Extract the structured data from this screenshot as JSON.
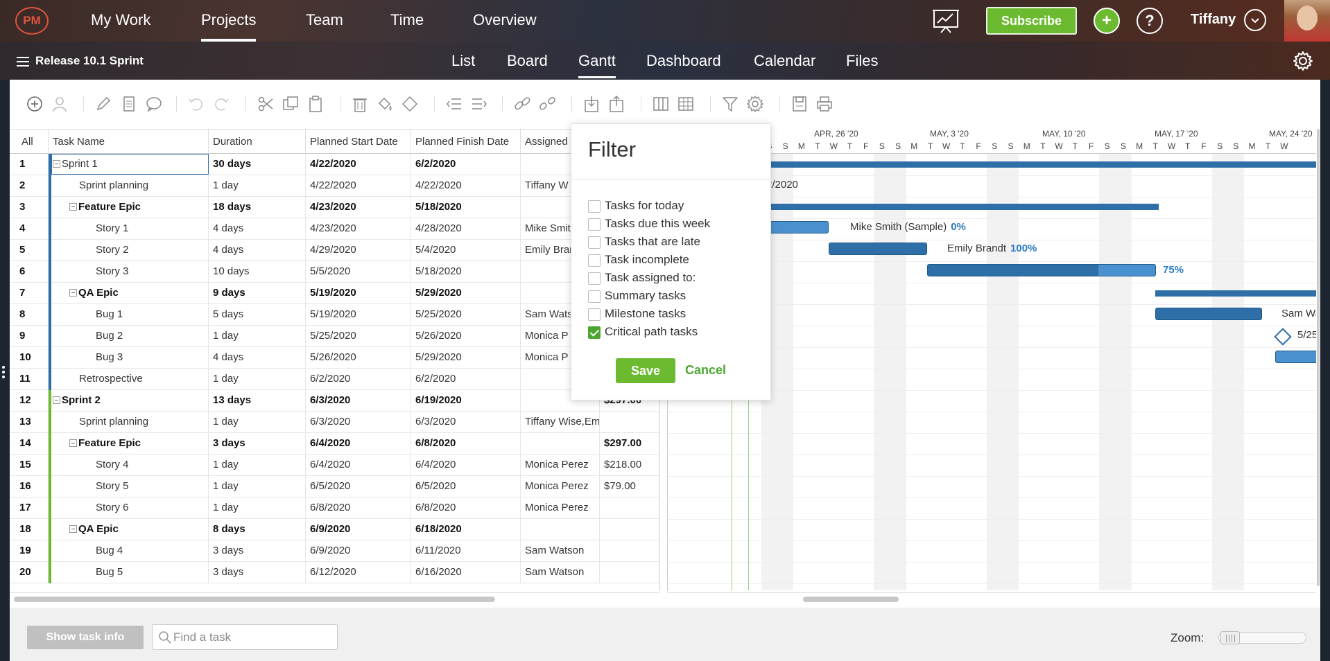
{
  "topnav": {
    "logo": "PM",
    "items": [
      {
        "label": "My Work",
        "active": false
      },
      {
        "label": "Projects",
        "active": true
      },
      {
        "label": "Team",
        "active": false
      },
      {
        "label": "Time",
        "active": false
      },
      {
        "label": "Overview",
        "active": false
      }
    ],
    "subscribe_label": "Subscribe",
    "user_name": "Tiffany"
  },
  "project": {
    "title": "Release 10.1 Sprint",
    "views": [
      {
        "label": "List",
        "active": false
      },
      {
        "label": "Board",
        "active": false
      },
      {
        "label": "Gantt",
        "active": true
      },
      {
        "label": "Dashboard",
        "active": false
      },
      {
        "label": "Calendar",
        "active": false
      },
      {
        "label": "Files",
        "active": false
      }
    ]
  },
  "toolbar_icons": [
    "add-task-icon",
    "assign-user-icon",
    "edit-icon",
    "notes-icon",
    "comment-icon",
    "undo-icon",
    "redo-icon",
    "cut-icon",
    "copy-icon",
    "paste-icon",
    "delete-icon",
    "fill-color-icon",
    "clear-format-icon",
    "outdent-icon",
    "indent-icon",
    "link-icon",
    "unlink-icon",
    "import-icon",
    "export-icon",
    "columns-icon",
    "table-icon",
    "filter-icon",
    "settings-icon",
    "save-baseline-icon",
    "print-icon"
  ],
  "grid": {
    "columns": [
      "All",
      "Task Name",
      "Duration",
      "Planned Start Date",
      "Planned Finish Date",
      "Assigned"
    ],
    "rows": [
      {
        "num": "1",
        "name": "Sprint 1",
        "duration": "30 days",
        "start": "4/22/2020",
        "finish": "6/2/2020",
        "assigned": "",
        "cost": "",
        "level": 0,
        "summary": true,
        "sprint": 1
      },
      {
        "num": "2",
        "name": "Sprint planning",
        "duration": "1 day",
        "start": "4/22/2020",
        "finish": "4/22/2020",
        "assigned": "Tiffany W",
        "cost": "",
        "level": 1,
        "summary": false,
        "sprint": 1
      },
      {
        "num": "3",
        "name": "Feature Epic",
        "duration": "18 days",
        "start": "4/23/2020",
        "finish": "5/18/2020",
        "assigned": "",
        "cost": "",
        "level": 1,
        "summary": true,
        "sprint": 1
      },
      {
        "num": "4",
        "name": "Story 1",
        "duration": "4 days",
        "start": "4/23/2020",
        "finish": "4/28/2020",
        "assigned": "Mike Smit",
        "cost": "",
        "level": 2,
        "summary": false,
        "sprint": 1
      },
      {
        "num": "5",
        "name": "Story 2",
        "duration": "4 days",
        "start": "4/29/2020",
        "finish": "5/4/2020",
        "assigned": "Emily Bran",
        "cost": "",
        "level": 2,
        "summary": false,
        "sprint": 1
      },
      {
        "num": "6",
        "name": "Story 3",
        "duration": "10 days",
        "start": "5/5/2020",
        "finish": "5/18/2020",
        "assigned": "",
        "cost": "",
        "level": 2,
        "summary": false,
        "sprint": 1
      },
      {
        "num": "7",
        "name": "QA Epic",
        "duration": "9 days",
        "start": "5/19/2020",
        "finish": "5/29/2020",
        "assigned": "",
        "cost": "",
        "level": 1,
        "summary": true,
        "sprint": 1
      },
      {
        "num": "8",
        "name": "Bug 1",
        "duration": "5 days",
        "start": "5/19/2020",
        "finish": "5/25/2020",
        "assigned": "Sam Wats",
        "cost": "",
        "level": 2,
        "summary": false,
        "sprint": 1
      },
      {
        "num": "9",
        "name": "Bug 2",
        "duration": "1 day",
        "start": "5/25/2020",
        "finish": "5/26/2020",
        "assigned": "Monica P",
        "cost": "",
        "level": 2,
        "summary": false,
        "sprint": 1
      },
      {
        "num": "10",
        "name": "Bug 3",
        "duration": "4 days",
        "start": "5/26/2020",
        "finish": "5/29/2020",
        "assigned": "Monica P",
        "cost": "",
        "level": 2,
        "summary": false,
        "sprint": 1
      },
      {
        "num": "11",
        "name": "Retrospective",
        "duration": "1 day",
        "start": "6/2/2020",
        "finish": "6/2/2020",
        "assigned": "",
        "cost": "",
        "level": 1,
        "summary": false,
        "sprint": 1
      },
      {
        "num": "12",
        "name": "Sprint 2",
        "duration": "13 days",
        "start": "6/3/2020",
        "finish": "6/19/2020",
        "assigned": "",
        "cost": "$297.00",
        "level": 0,
        "summary": true,
        "sprint": 2
      },
      {
        "num": "13",
        "name": "Sprint planning",
        "duration": "1 day",
        "start": "6/3/2020",
        "finish": "6/3/2020",
        "assigned": "Tiffany Wise,Em",
        "cost": "",
        "level": 1,
        "summary": false,
        "sprint": 2
      },
      {
        "num": "14",
        "name": "Feature Epic",
        "duration": "3 days",
        "start": "6/4/2020",
        "finish": "6/8/2020",
        "assigned": "",
        "cost": "$297.00",
        "level": 1,
        "summary": true,
        "sprint": 2
      },
      {
        "num": "15",
        "name": "Story 4",
        "duration": "1 day",
        "start": "6/4/2020",
        "finish": "6/4/2020",
        "assigned": "Monica Perez",
        "cost": "$218.00",
        "level": 2,
        "summary": false,
        "sprint": 2
      },
      {
        "num": "16",
        "name": "Story 5",
        "duration": "1 day",
        "start": "6/5/2020",
        "finish": "6/5/2020",
        "assigned": "Monica Perez",
        "cost": "$79.00",
        "level": 2,
        "summary": false,
        "sprint": 2
      },
      {
        "num": "17",
        "name": "Story 6",
        "duration": "1 day",
        "start": "6/8/2020",
        "finish": "6/8/2020",
        "assigned": "Monica Perez",
        "cost": "",
        "level": 2,
        "summary": false,
        "sprint": 2
      },
      {
        "num": "18",
        "name": "QA Epic",
        "duration": "8 days",
        "start": "6/9/2020",
        "finish": "6/18/2020",
        "assigned": "",
        "cost": "",
        "level": 1,
        "summary": true,
        "sprint": 2
      },
      {
        "num": "19",
        "name": "Bug 4",
        "duration": "3 days",
        "start": "6/9/2020",
        "finish": "6/11/2020",
        "assigned": "Sam Watson",
        "cost": "",
        "level": 2,
        "summary": false,
        "sprint": 2
      },
      {
        "num": "20",
        "name": "Bug 5",
        "duration": "3 days",
        "start": "6/12/2020",
        "finish": "6/16/2020",
        "assigned": "Sam Watson",
        "cost": "",
        "level": 2,
        "summary": false,
        "sprint": 2
      }
    ]
  },
  "gantt": {
    "weeks": [
      "APR, 26 '20",
      "MAY, 3 '20",
      "MAY, 10 '20",
      "MAY, 17 '20",
      "MAY, 24 '20"
    ],
    "day_letters": [
      "S",
      "S",
      "M",
      "T",
      "W",
      "T",
      "F",
      "S",
      "S",
      "M",
      "T",
      "W",
      "T",
      "F",
      "S",
      "S",
      "M",
      "T",
      "W",
      "T",
      "F",
      "S",
      "S",
      "M",
      "T",
      "W",
      "T",
      "F",
      "S",
      "S",
      "M",
      "T",
      "W"
    ],
    "labels": {
      "row2": "2/2020",
      "row4_name": "Mike Smith (Sample)",
      "row4_pct": "0%",
      "row5_name": "Emily Brandt",
      "row5_pct": "100%",
      "row6_pct": "75%",
      "row8_name": "Sam Wa",
      "row9_date": "5/25"
    },
    "progress": {
      "story_1": 0,
      "story_2": 100,
      "story_3": 75
    }
  },
  "filter": {
    "title": "Filter",
    "options": [
      {
        "label": "Tasks for today",
        "checked": false
      },
      {
        "label": "Tasks due this week",
        "checked": false
      },
      {
        "label": "Tasks that are late",
        "checked": false
      },
      {
        "label": "Task incomplete",
        "checked": false
      },
      {
        "label": "Task assigned to:",
        "checked": false
      },
      {
        "label": "Summary tasks",
        "checked": false
      },
      {
        "label": "Milestone tasks",
        "checked": false
      },
      {
        "label": "Critical path tasks",
        "checked": true
      }
    ],
    "save_label": "Save",
    "cancel_label": "Cancel"
  },
  "footer": {
    "show_task_info": "Show task info",
    "find_placeholder": "Find a task",
    "zoom_label": "Zoom:"
  },
  "colors": {
    "sprint1_stripe": "#2e6fa7",
    "sprint2_stripe": "#6bba2f",
    "accent_green": "#6bba2f",
    "bar_blue": "#2e6fa7"
  }
}
